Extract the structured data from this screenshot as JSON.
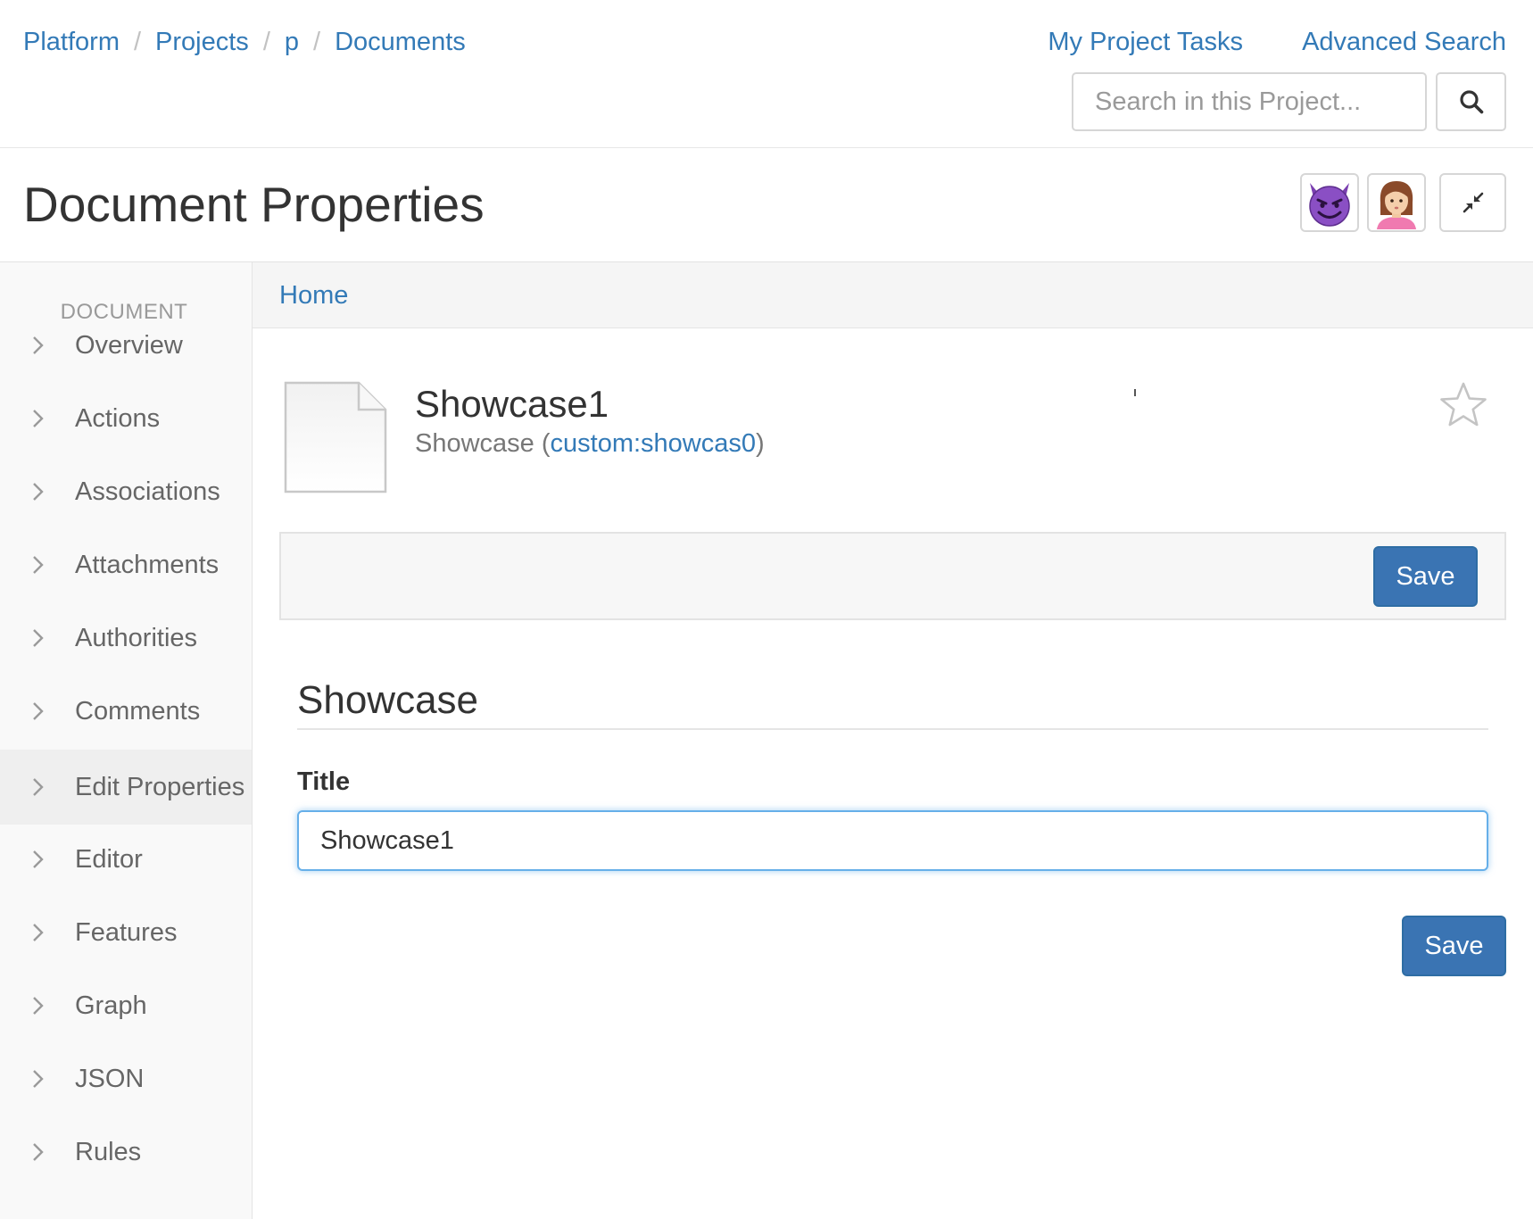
{
  "breadcrumb": {
    "items": [
      "Platform",
      "Projects",
      "p",
      "Documents"
    ],
    "separator": "/"
  },
  "top_links": {
    "tasks": "My Project Tasks",
    "advanced_search": "Advanced Search"
  },
  "search": {
    "placeholder": "Search in this Project...",
    "value": "",
    "button_icon": "search-icon"
  },
  "page": {
    "title": "Document Properties"
  },
  "header_icons": {
    "avatar_1": "smiling-devil-emoji-avatar",
    "avatar_2": "woman-emoji-avatar",
    "collapse": "collapse-arrows-icon"
  },
  "sidebar": {
    "heading": "DOCUMENT",
    "items": [
      {
        "label": "Overview",
        "active": false
      },
      {
        "label": "Actions",
        "active": false
      },
      {
        "label": "Associations",
        "active": false
      },
      {
        "label": "Attachments",
        "active": false
      },
      {
        "label": "Authorities",
        "active": false
      },
      {
        "label": "Comments",
        "active": false
      },
      {
        "label": "Edit Properties",
        "active": true
      },
      {
        "label": "Editor",
        "active": false
      },
      {
        "label": "Features",
        "active": false
      },
      {
        "label": "Graph",
        "active": false
      },
      {
        "label": "JSON",
        "active": false
      },
      {
        "label": "Rules",
        "active": false
      }
    ]
  },
  "content": {
    "breadcrumb_home": "Home",
    "document": {
      "name": "Showcase1",
      "type_prefix": "Showcase (",
      "type_link": "custom:showcas0",
      "type_suffix": ")",
      "icon": "blank-document-icon",
      "favorite_icon": "star-outline-icon"
    },
    "save_label": "Save",
    "form": {
      "section_title": "Showcase",
      "field_label": "Title",
      "field_value": "Showcase1"
    }
  },
  "colors": {
    "link": "#337ab7",
    "primary_button": "#3a74b3",
    "sidebar_bg": "#f9f9f9",
    "sidebar_active_bg": "#efefef",
    "focus_border": "#66afe9"
  }
}
